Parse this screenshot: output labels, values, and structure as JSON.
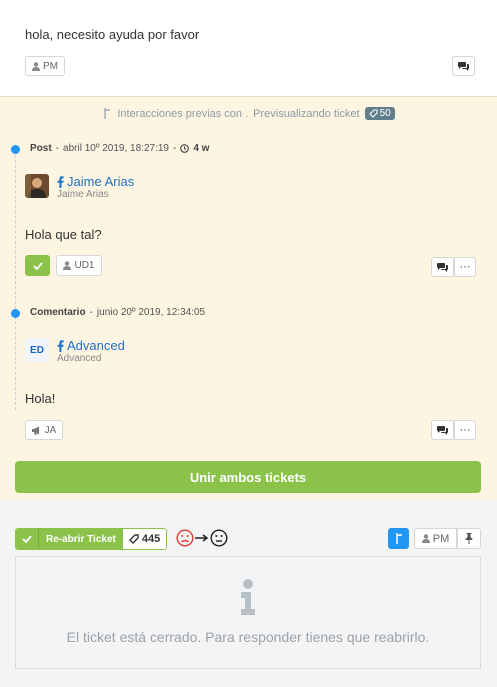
{
  "top_message": {
    "text": "hola, necesito ayuda por favor",
    "pm_label": "PM"
  },
  "preview_header": {
    "prefix": "Interacciones previas con .",
    "label": "Previsualizando ticket",
    "ticket_badge": "50"
  },
  "items": [
    {
      "type": "Post",
      "date": "abril 10º 2019, 18:27:19",
      "age": "4 w",
      "author_name": "Jaime Arias",
      "author_sub": "Jaime Arias",
      "message": "Hola que tal?",
      "agent_label": "UD1"
    },
    {
      "type": "Comentario",
      "date": "junio 20º 2019, 12:34:05",
      "author_name": "Advanced",
      "author_sub": "Advanced",
      "avatar_text": "ED",
      "message": "Hola!",
      "agent_label": "JA"
    }
  ],
  "merge_button": "Unir ambos tickets",
  "bottom": {
    "reopen_label": "Re-abrir Ticket",
    "ticket_count": "445",
    "pm_label": "PM",
    "closed_message": "El ticket está cerrado. Para responder tienes que reabrirlo."
  },
  "colors": {
    "accent_green": "#8bc34a",
    "accent_blue": "#2196f3",
    "link_blue": "#1d72c9",
    "preview_bg": "#fdf4e1",
    "sad_red": "#e53935"
  }
}
